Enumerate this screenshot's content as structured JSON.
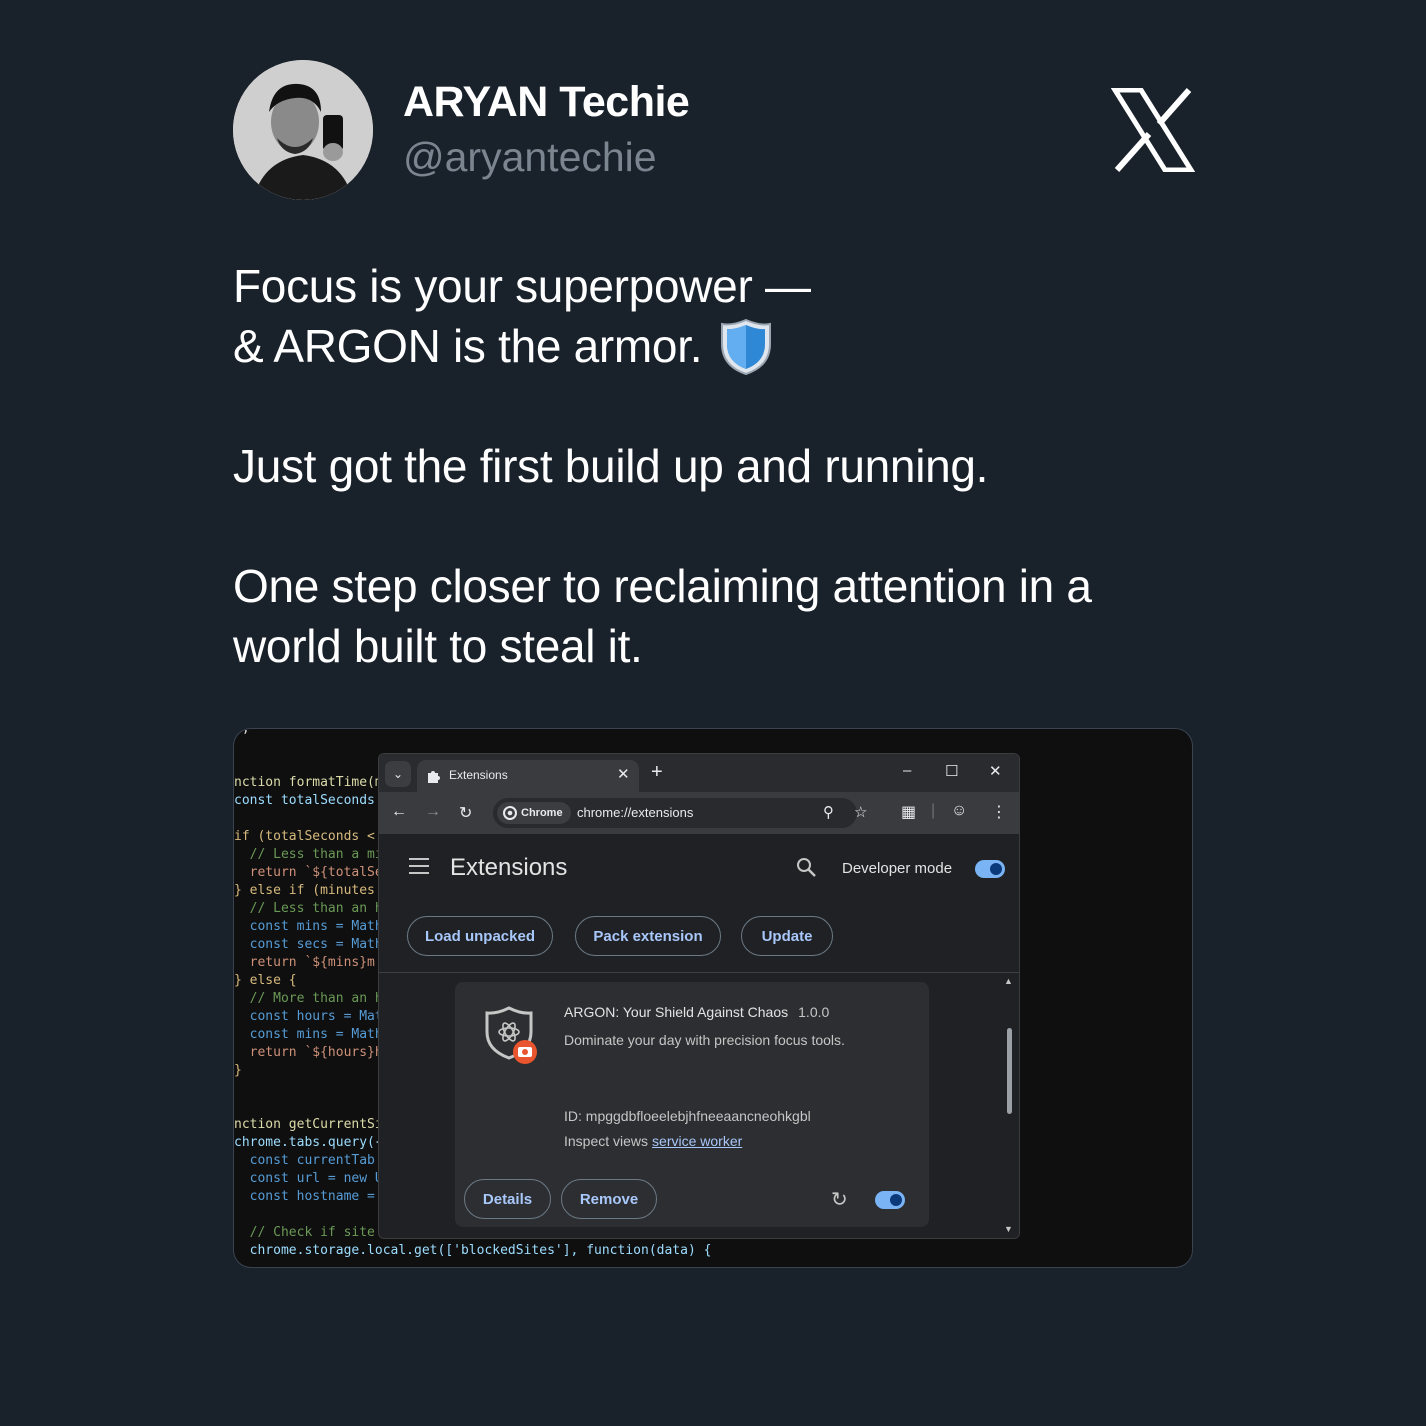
{
  "author": {
    "display_name": "ARYAN Techie",
    "handle": "@aryantechie"
  },
  "icons": {
    "platform_logo": "x-logo",
    "emoji": "shield-icon"
  },
  "tweet": {
    "line1": "Focus is your superpower —",
    "line2": "& ARGON is the armor.",
    "line3": "Just got the first build up and running.",
    "line4": "One step closer to reclaiming attention in a",
    "line5": "world built to steal it."
  },
  "media": {
    "code_lines": [
      "};",
      "nction formatTime(m",
      "const totalSeconds",
      "if (totalSeconds <",
      "  // Less than a mi",
      "  return `${totalSe",
      "} else if (minutes",
      "  // Less than an h",
      "  const mins = Math",
      "  const secs = Math",
      "  return `${mins}m",
      "} else {",
      "  // More than an h",
      "  const hours = Mat",
      "  const mins = Math",
      "  return `${hours}h",
      "}",
      "nction getCurrentSi",
      "chrome.tabs.query({",
      "  const currentTab",
      "  const url = new U",
      "  const hostname =",
      "  // Check if site is already blocked",
      "  chrome.storage.local.get(['blockedSites'], function(data) {"
    ],
    "browser": {
      "tab_title": "Extensions",
      "chip_label": "Chrome",
      "url": "chrome://extensions",
      "page_title": "Extensions",
      "developer_mode_label": "Developer mode",
      "developer_mode_on": true,
      "buttons": {
        "load_unpacked": "Load unpacked",
        "pack_extension": "Pack extension",
        "update": "Update"
      },
      "extension": {
        "name": "ARGON: Your Shield Against Chaos",
        "version": "1.0.0",
        "description": "Dominate your day with precision focus tools.",
        "id_text": "ID: mpggdbfloeelebjhfneeaancneohkgbl",
        "inspect_label": "Inspect views",
        "inspect_link": "service worker",
        "details_label": "Details",
        "remove_label": "Remove",
        "enabled": true
      }
    }
  },
  "colors": {
    "background": "#19212b",
    "handle": "#7b8590",
    "accent_blue": "#a8c7fa"
  }
}
